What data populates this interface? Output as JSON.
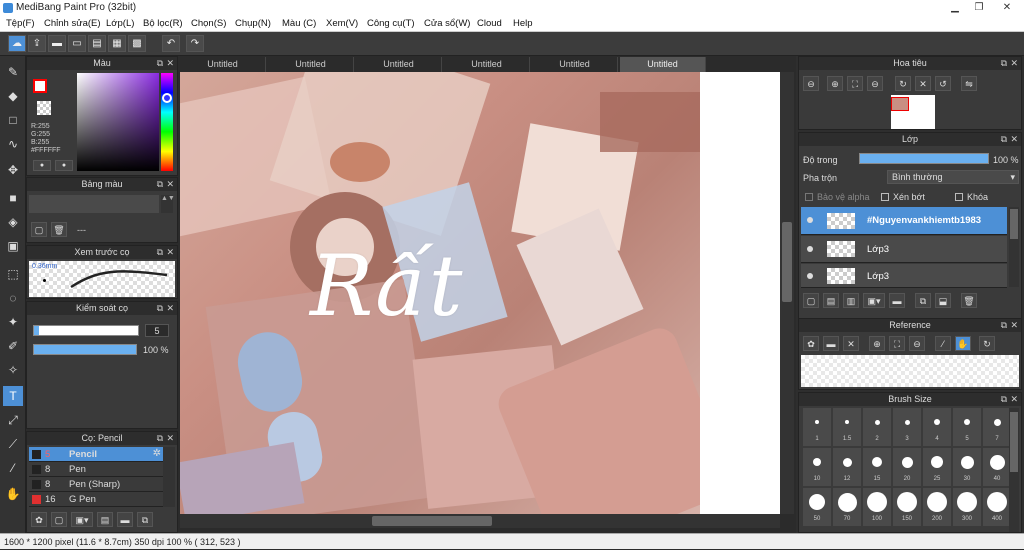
{
  "window": {
    "title": "MediBang Paint Pro (32bit)",
    "min": "▁",
    "max": "❐",
    "close": "✕"
  },
  "menu": [
    "Tệp(F)",
    "Chỉnh sửa(E)",
    "Lớp(L)",
    "Bộ lọc(R)",
    "Chọn(S)",
    "Chụp(N)",
    "Màu (C)",
    "Xem(V)",
    "Công cụ(T)",
    "Cửa sổ(W)",
    "Cloud",
    "Help"
  ],
  "tabs": [
    "Untitled",
    "Untitled",
    "Untitled",
    "Untitled",
    "Untitled",
    "Untitled"
  ],
  "color_panel": {
    "title": "Màu",
    "r": "R:255",
    "g": "G:255",
    "b": "B:255",
    "hex": "#FFFFFF",
    "fg": "#ff0000",
    "bg": "#ffffff"
  },
  "palette_panel": {
    "title": "Bảng màu",
    "dash": "---"
  },
  "brush_preview": {
    "title": "Xem trước cọ",
    "size": "0.36mm"
  },
  "brush_control": {
    "title": "Kiểm soát cọ",
    "size": "5",
    "opacity": "100 %",
    "size_fill": 0.05,
    "opacity_fill": 1.0
  },
  "brush_list": {
    "title": "Cọ: Pencil",
    "items": [
      {
        "num": "5",
        "name": "Pencil",
        "color": "#222222"
      },
      {
        "num": "8",
        "name": "Pen",
        "color": "#222222"
      },
      {
        "num": "8",
        "name": "Pen (Sharp)",
        "color": "#222222"
      },
      {
        "num": "16",
        "name": "G Pen",
        "color": "#e03030"
      }
    ]
  },
  "canvas": {
    "big_text": "Rất"
  },
  "navigator": {
    "title": "Hoa tiêu"
  },
  "layer_panel": {
    "title": "Lớp",
    "opacity_label": "Độ trong",
    "opacity_value": "100 %",
    "blend_label": "Pha trộn",
    "blend_value": "Bình thường",
    "protect_alpha": "Bảo vệ alpha",
    "clipping": "Xén bớt",
    "lock": "Khóa",
    "layers": [
      "#Nguyenvankhiemtb1983",
      "Lớp3",
      "Lớp3"
    ]
  },
  "reference": {
    "title": "Reference"
  },
  "brush_size": {
    "title": "Brush Size",
    "sizes": [
      "1",
      "1.5",
      "2",
      "3",
      "4",
      "5",
      "7",
      "10",
      "12",
      "15",
      "20",
      "25",
      "30",
      "40",
      "50",
      "70",
      "100",
      "150",
      "200",
      "300",
      "400"
    ]
  },
  "status": {
    "text": "1600 * 1200 pixel   (11.6 * 8.7cm)   350 dpi   100 %   ( 312, 523 )"
  },
  "colors": {
    "accent": "#4d90d6",
    "panel": "#3a3a3a",
    "dark": "#2b2b2b"
  }
}
